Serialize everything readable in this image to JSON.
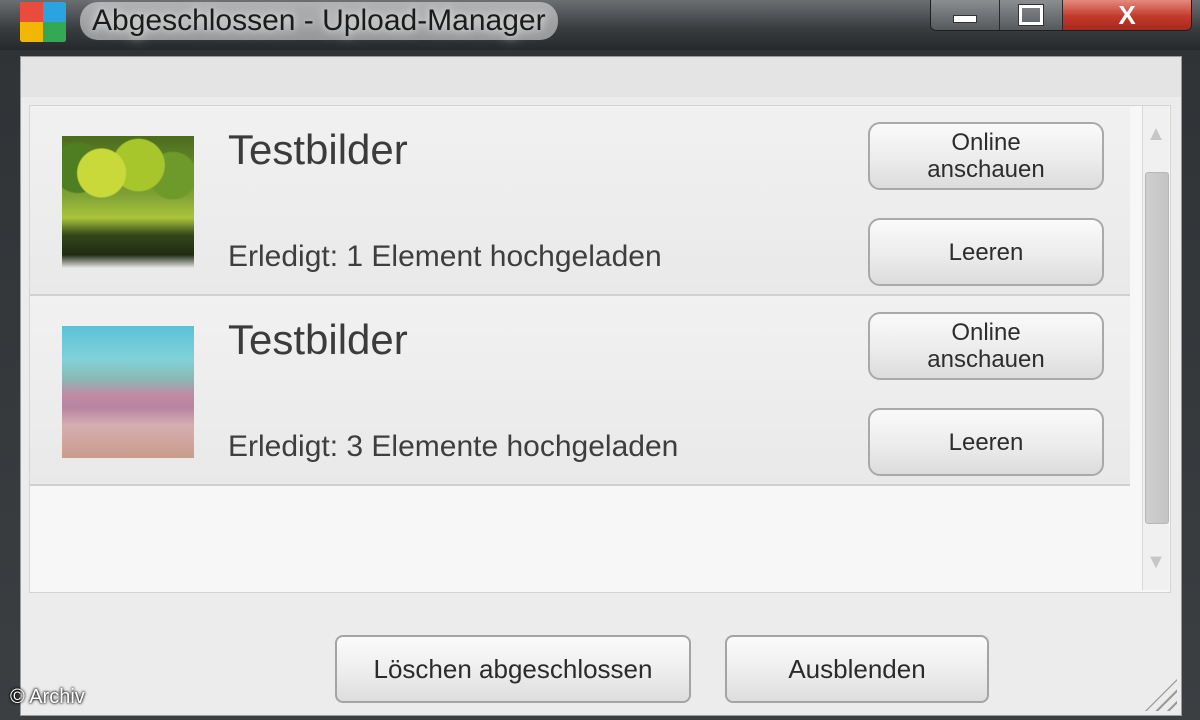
{
  "window": {
    "title": "Abgeschlossen - Upload-Manager",
    "close_glyph": "X"
  },
  "uploads": [
    {
      "title": "Testbilder",
      "status": "Erledigt: 1 Element hochgeladen",
      "thumbnail": "trees-thumbnail",
      "online_label": "Online anschauen",
      "clear_label": "Leeren"
    },
    {
      "title": "Testbilder",
      "status": "Erledigt: 3 Elemente hochgeladen",
      "thumbnail": "beach-thumbnail",
      "online_label": "Online anschauen",
      "clear_label": "Leeren"
    }
  ],
  "footer": {
    "delete_completed_label": "Löschen abgeschlossen",
    "hide_label": "Ausblenden"
  },
  "watermark": "© Archiv",
  "icons": {
    "scroll_up": "chevron-up-icon",
    "scroll_down": "chevron-down-icon"
  },
  "colors": {
    "close_button": "#c2392b",
    "window_frame": "#3b3f42"
  }
}
